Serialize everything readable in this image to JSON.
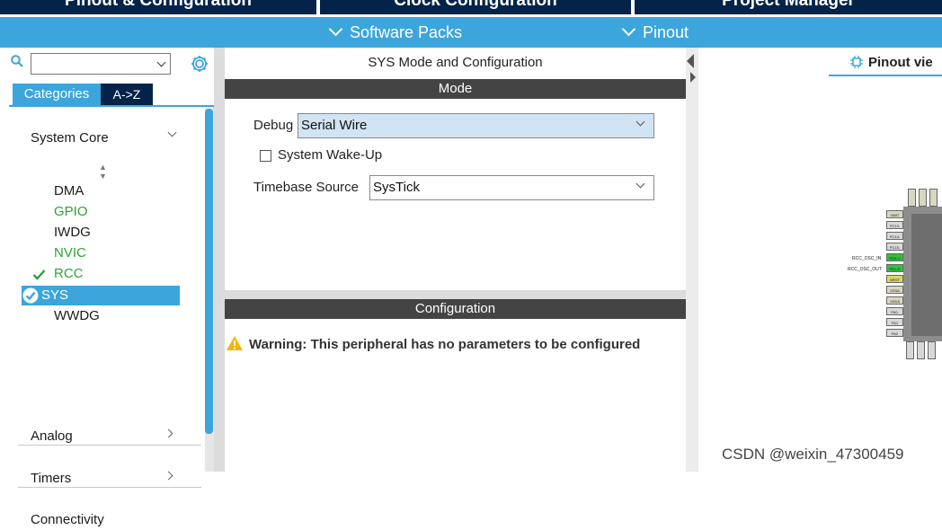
{
  "tabs": {
    "pinout_config": "Pinout & Configuration",
    "clock_config": "Clock Configuration",
    "project_manager": "Project Manager"
  },
  "subbar": {
    "software_packs": "Software Packs",
    "pinout": "Pinout"
  },
  "left": {
    "categories_tab": "Categories",
    "az_tab": "A->Z",
    "search_placeholder": "",
    "system_core": "System Core",
    "items": [
      "DMA",
      "GPIO",
      "IWDG",
      "NVIC",
      "RCC",
      "SYS",
      "WWDG"
    ],
    "analog": "Analog",
    "timers": "Timers",
    "connectivity": "Connectivity"
  },
  "middle": {
    "title": "SYS Mode and Configuration",
    "mode_header": "Mode",
    "debug_label": "Debug",
    "debug_value": "Serial Wire",
    "wakeup_label": "System Wake-Up",
    "timebase_label": "Timebase Source",
    "timebase_value": "SysTick",
    "config_header": "Configuration",
    "warning": "Warning: This peripheral has no parameters to be configured"
  },
  "right": {
    "pinout_view": "Pinout vie",
    "pins_left": [
      "VBAT",
      "PC13-",
      "PC14-",
      "PC15-",
      "PD0-O",
      "PD1-O",
      "NRST",
      "VSSA",
      "VDDA",
      "PA0-",
      "PA1",
      "PA2"
    ],
    "signal_in": "RCC_OSC_IN",
    "signal_out": "RCC_OSC_OUT"
  },
  "watermark": "CSDN @weixin_47300459",
  "colors": {
    "dark_navy": "#03234b",
    "accent_blue": "#3ca5dc",
    "header_gray": "#444444",
    "enabled_green": "#2fa13a",
    "warning_yellow": "#f5b400"
  },
  "icons": {
    "search": "search-icon",
    "settings": "gear-icon",
    "check": "check-icon",
    "warning": "warning-icon",
    "chip": "chip-icon"
  }
}
